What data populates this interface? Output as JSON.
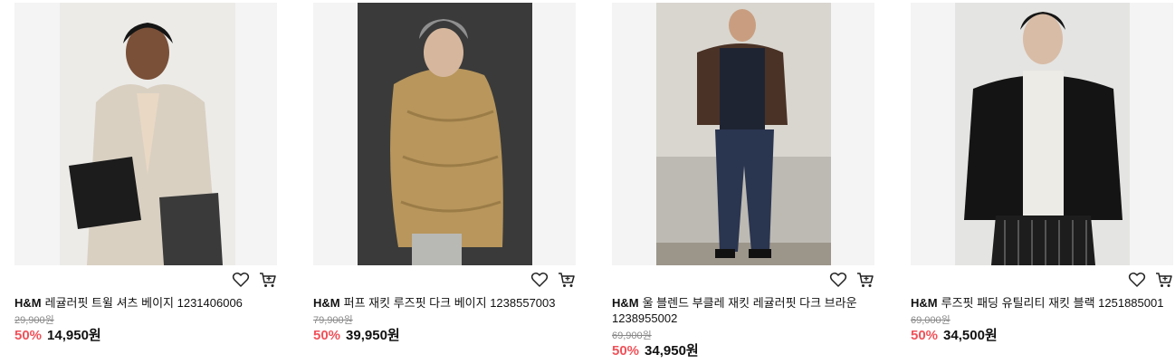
{
  "products": [
    {
      "brand": "H&M",
      "name": "레귤러핏 트윌 셔츠 베이지 1231406006",
      "original_price": "29,900원",
      "discount": "50%",
      "price": "14,950원"
    },
    {
      "brand": "H&M",
      "name": "퍼프 재킷 루즈핏 다크 베이지 1238557003",
      "original_price": "79,900원",
      "discount": "50%",
      "price": "39,950원"
    },
    {
      "brand": "H&M",
      "name": "울 블렌드 부클레 재킷 레귤러핏 다크 브라운 1238955002",
      "original_price": "69,900원",
      "discount": "50%",
      "price": "34,950원"
    },
    {
      "brand": "H&M",
      "name": "루즈핏 패딩 유틸리티 재킷 블랙 1251885001",
      "original_price": "69,000원",
      "discount": "50%",
      "price": "34,500원"
    }
  ],
  "icons": {
    "wishlist": "heart-icon",
    "cart": "cart-icon"
  },
  "colors": {
    "discount": "#f0525a",
    "thumb_bg": "#f4f4f4"
  }
}
